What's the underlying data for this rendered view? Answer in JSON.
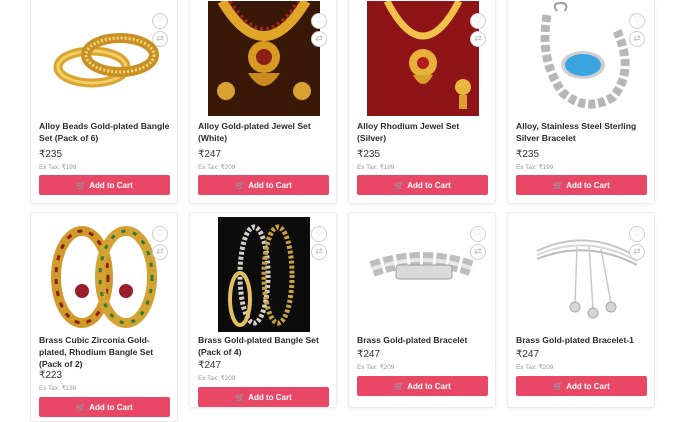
{
  "cart_label": "Add to Cart",
  "products": [
    {
      "name": "Alloy Beads Gold-plated Bangle Set (Pack of 6)",
      "price": "₹235",
      "ex_tax": "Ex Tax: ₹199"
    },
    {
      "name": "Alloy Gold-plated Jewel Set (White)",
      "price": "₹247",
      "ex_tax": "Ex Tax: ₹209"
    },
    {
      "name": "Alloy Rhodium Jewel Set (Silver)",
      "price": "₹235",
      "ex_tax": "Ex Tax: ₹199"
    },
    {
      "name": "Alloy, Stainless Steel Sterling Silver Bracelet",
      "price": "₹235",
      "ex_tax": "Ex Tax: ₹199"
    },
    {
      "name": "Brass Cubic Zirconia Gold-plated, Rhodium Bangle Set (Pack of 2)",
      "price": "₹223",
      "ex_tax": "Ex Tax: ₹189"
    },
    {
      "name": "Brass Gold-plated Bangle Set (Pack of 4)",
      "price": "₹247",
      "ex_tax": "Ex Tax: ₹209"
    },
    {
      "name": "Brass Gold-plated Bracelet",
      "price": "₹247",
      "ex_tax": "Ex Tax: ₹209"
    },
    {
      "name": "Brass Gold-plated Bracelet-1",
      "price": "₹247",
      "ex_tax": "Ex Tax: ₹209"
    }
  ],
  "icons": {
    "wishlist": "heart-icon",
    "compare": "compare-icon",
    "cart": "shopping-cart-icon"
  },
  "colors": {
    "cart_button": "#e84766"
  }
}
